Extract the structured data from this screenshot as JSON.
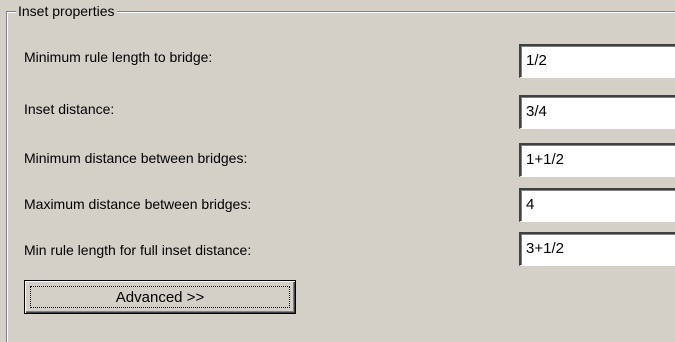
{
  "group": {
    "title": "Inset properties"
  },
  "rows": [
    {
      "label": "Minimum rule length to bridge:",
      "value": "1/2"
    },
    {
      "label": "Inset distance:",
      "value": "3/4"
    },
    {
      "label": "Minimum distance between bridges:",
      "value": "1+1/2"
    },
    {
      "label": "Maximum distance between bridges:",
      "value": "4"
    },
    {
      "label": "Min rule length for full inset distance:",
      "value": "3+1/2"
    }
  ],
  "advanced_button": {
    "label": "Advanced >>"
  }
}
